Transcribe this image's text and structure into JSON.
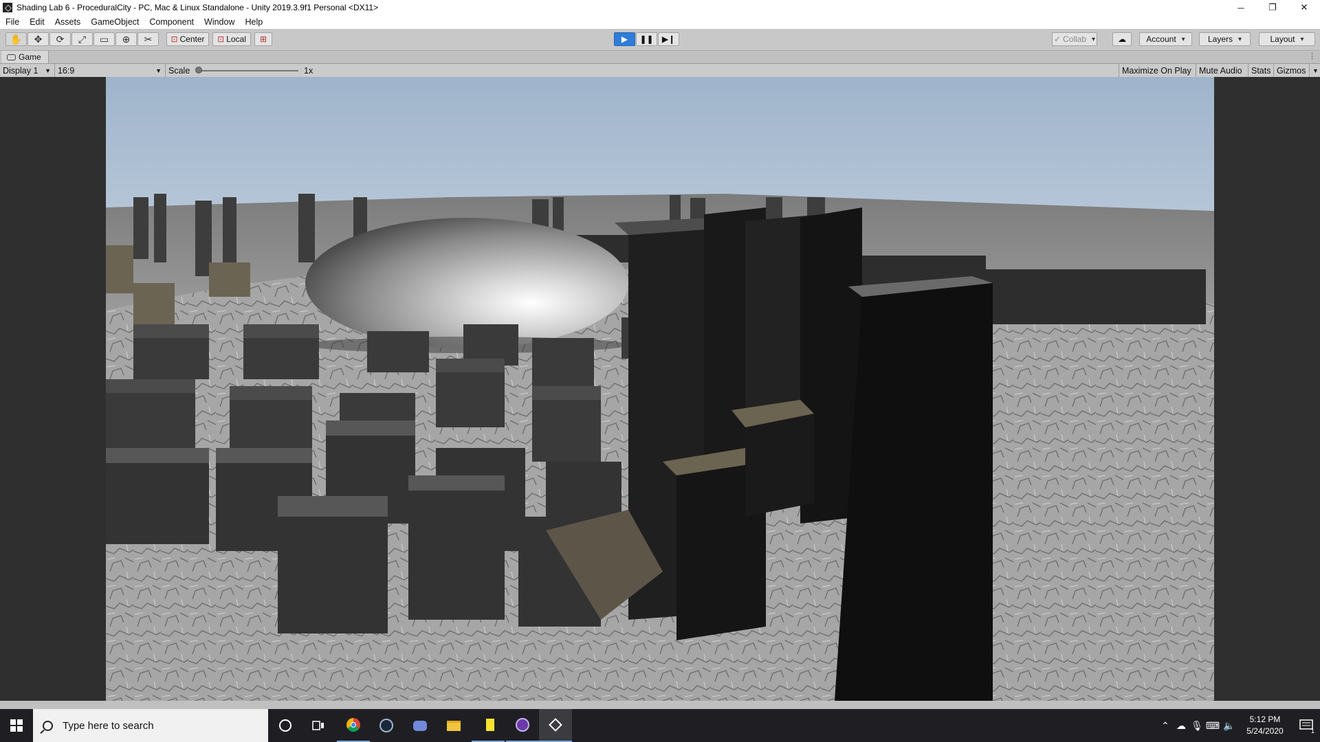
{
  "window": {
    "title": "Shading Lab 6 - ProceduralCity - PC, Mac & Linux Standalone - Unity 2019.3.9f1 Personal <DX11>",
    "minimize": "─",
    "maximize": "❐",
    "close": "✕"
  },
  "menu": [
    "File",
    "Edit",
    "Assets",
    "GameObject",
    "Component",
    "Window",
    "Help"
  ],
  "toolbar": {
    "pivot": "Center",
    "space": "Local",
    "collab": "Collab",
    "account": "Account",
    "layers": "Layers",
    "layout": "Layout"
  },
  "panel": {
    "tab": "Game"
  },
  "gamebar": {
    "display": "Display 1",
    "aspect": "16:9",
    "scale_label": "Scale",
    "scale_value": "1x",
    "maximize": "Maximize On Play",
    "mute": "Mute Audio",
    "stats": "Stats",
    "gizmos": "Gizmos"
  },
  "taskbar": {
    "search_placeholder": "Type here to search",
    "time": "5:12 PM",
    "date": "5/24/2020",
    "notification_count": "1"
  },
  "colors": {
    "play_active": "#2f7dd9",
    "sky_top": "#a9bdd2",
    "ground": "#8a8a8a",
    "taskbar": "#1f1f23"
  }
}
